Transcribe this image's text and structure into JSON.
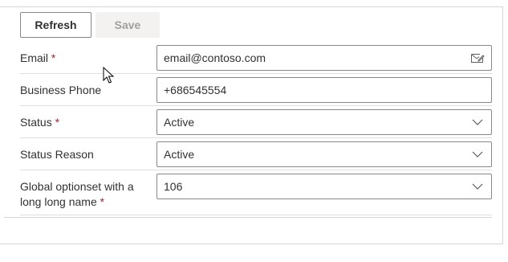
{
  "toolbar": {
    "refresh_label": "Refresh",
    "save_label": "Save"
  },
  "form": {
    "email": {
      "label": "Email",
      "required": "*",
      "value": "email@contoso.com",
      "icon": "mail-compose-icon"
    },
    "phone": {
      "label": "Business Phone",
      "value": "+686545554"
    },
    "status": {
      "label": "Status",
      "required": "*",
      "value": "Active",
      "icon": "chevron-down-icon"
    },
    "status_reason": {
      "label": "Status Reason",
      "value": "Active",
      "icon": "chevron-down-icon"
    },
    "global_optionset": {
      "label": "Global optionset with a long long name",
      "required": "*",
      "value": "106",
      "icon": "chevron-down-icon"
    }
  },
  "colors": {
    "required": "#a4262c",
    "border": "#8a8886",
    "disabled_bg": "#f3f2f1",
    "disabled_text": "#a19f9d"
  }
}
